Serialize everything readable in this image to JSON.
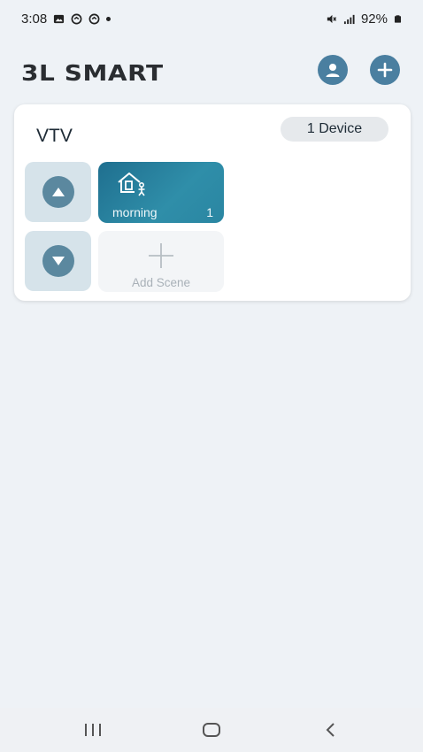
{
  "status_bar": {
    "time": "3:08",
    "battery": "92%",
    "left_icons": [
      "image-icon",
      "sync-icon",
      "sync-icon",
      "dot-icon"
    ],
    "right_icons": [
      "mute-icon",
      "signal-icon",
      "battery-icon"
    ]
  },
  "header": {
    "brand": "3L SMART",
    "profile_icon": "user-icon",
    "add_icon": "plus-icon"
  },
  "room": {
    "name": "VTV",
    "device_count_label": "1 Device",
    "scenes": [
      {
        "name": "morning",
        "count": "1",
        "icon": "home-person-icon"
      }
    ],
    "add_scene_label": "Add Scene"
  },
  "colors": {
    "accent": "#4a7fa0",
    "scene_tile": "#2a86a2",
    "nav_button_bg": "#d6e3ea",
    "background": "#eef2f6"
  }
}
